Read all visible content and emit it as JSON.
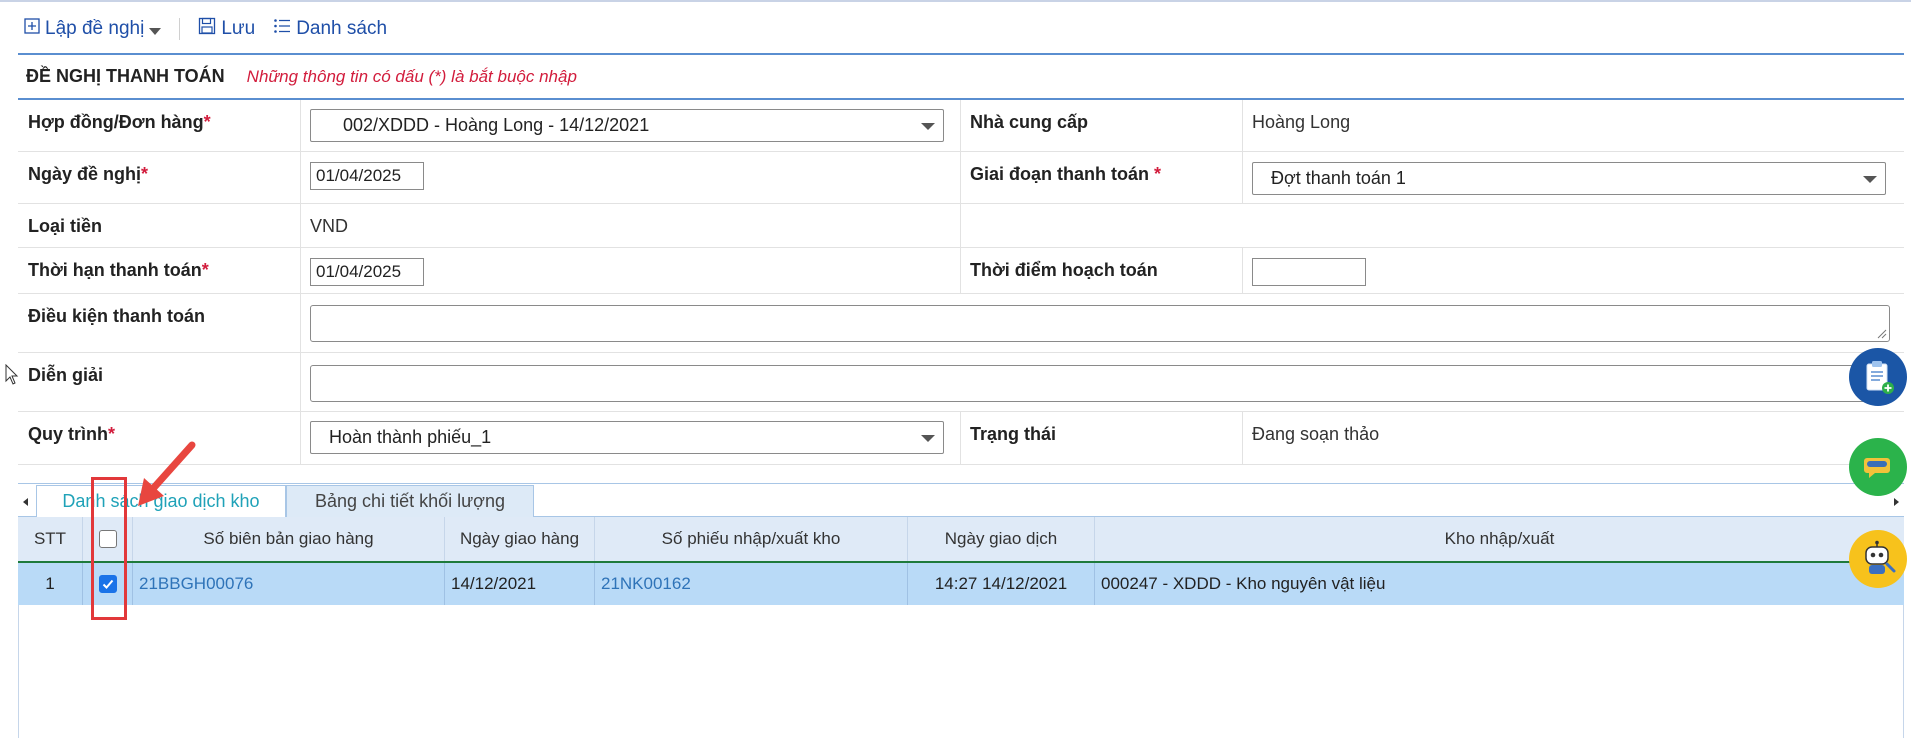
{
  "toolbar": {
    "create_label": "Lập đề nghị",
    "save_label": "Lưu",
    "list_label": "Danh sách"
  },
  "form": {
    "title": "ĐỀ NGHỊ THANH TOÁN",
    "note": "Những thông tin có dấu (*) là bắt buộc nhập",
    "contract_label": "Hợp đồng/Đơn hàng",
    "contract_value": "002/XDDD - Hoàng Long - 14/12/2021",
    "supplier_label": "Nhà cung cấp",
    "supplier_value": "Hoàng Long",
    "request_date_label": "Ngày đề nghị",
    "request_date_value": "01/04/2025",
    "payment_phase_label": "Giai đoạn thanh toán",
    "payment_phase_value": "Đợt thanh toán 1",
    "currency_label": "Loại tiền",
    "currency_value": "VND",
    "payment_deadline_label": "Thời hạn thanh toán",
    "payment_deadline_value": "01/04/2025",
    "accounting_time_label": "Thời điểm hoạch toán",
    "accounting_time_value": "",
    "payment_terms_label": "Điều kiện thanh toán",
    "description_label": "Diễn giải",
    "workflow_label": "Quy trình",
    "workflow_value": "Hoàn thành phiếu_1",
    "status_label": "Trạng thái",
    "status_value": "Đang soạn thảo",
    "required_mark": "*"
  },
  "tabs": [
    {
      "label": "Danh sách giao dịch kho",
      "active": true
    },
    {
      "label": "Bảng chi tiết khối lượng",
      "active": false
    }
  ],
  "grid": {
    "columns": [
      "STT",
      "",
      "Số biên bản giao hàng",
      "Ngày giao hàng",
      "Số phiếu nhập/xuất kho",
      "Ngày giao dịch",
      "Kho nhập/xuất"
    ],
    "rows": [
      {
        "stt": "1",
        "checked": true,
        "delivery_record": "21BBGH00076",
        "delivery_date": "14/12/2021",
        "warehouse_slip": "21NK00162",
        "transaction_date": "14:27 14/12/2021",
        "warehouse": "000247 - XDDD - Kho nguyên vật liệu"
      }
    ]
  },
  "colors": {
    "accent": "#1f4fa8",
    "required": "#d21c3c",
    "selected_row": "#b9daf7",
    "annotation": "#e2383a"
  }
}
